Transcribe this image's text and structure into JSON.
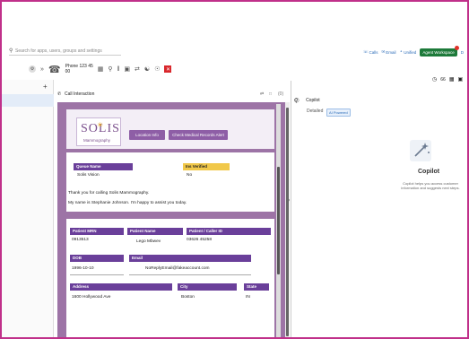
{
  "search": {
    "placeholder": "Search for apps, users, groups and settings"
  },
  "top_actions": {
    "calls": "Calls",
    "email": "Email",
    "unified": "Unified",
    "agent_workspace": "Agent Workspace",
    "trailing": "D"
  },
  "toolbar": {
    "caller_line1": "Phone 123 45",
    "caller_line2": "00"
  },
  "center": {
    "tab_title": "Call Interaction",
    "tab_count": "(0)"
  },
  "form": {
    "logo_text": "SOLIS",
    "logo_sub": "Mammography",
    "buttons": {
      "location": "Location Info",
      "check": "Check Medical Records Alert"
    },
    "queue_name_label": "Queue Name",
    "queue_name_value": "Solis Vision",
    "ins_verified_label": "Ins Verified",
    "ins_verified_value": "No",
    "greeting": "Thank you for calling Solis Mammography.",
    "intro": "My name is Stephanie Johnson. I'm happy to assist you today.",
    "patient_mrn_label": "Patient MRN",
    "patient_mrn_value": "0913513",
    "patient_name_label": "Patient Name",
    "patient_name_value": "Lego Mbwev",
    "patient_callerid_label": "Patient / Caller ID",
    "patient_callerid_value": "03626 45258",
    "dob_label": "DOB",
    "dob_value": "1996-10-10",
    "email_label": "Email",
    "email_value": "NoReplyEmail@fakeaccount.com",
    "address_label": "Address",
    "address_value": "1600 Hollywood Ave",
    "city_label": "City",
    "city_value": "Boston",
    "state_label": "State",
    "state_value": "IN"
  },
  "copilot": {
    "tab_title": "Copilot",
    "badge_prefix": "Detailed",
    "badge": "AI Powered",
    "count": "66",
    "title": "Copilot",
    "description": "Copilot helps you access customer information and suggests next steps."
  },
  "colors": {
    "accent": "#6a3f9a",
    "panel": "#9d74a6",
    "frame": "#c0308a",
    "agent_workspace": "#1d7a3a",
    "alert": "#d9262b"
  }
}
